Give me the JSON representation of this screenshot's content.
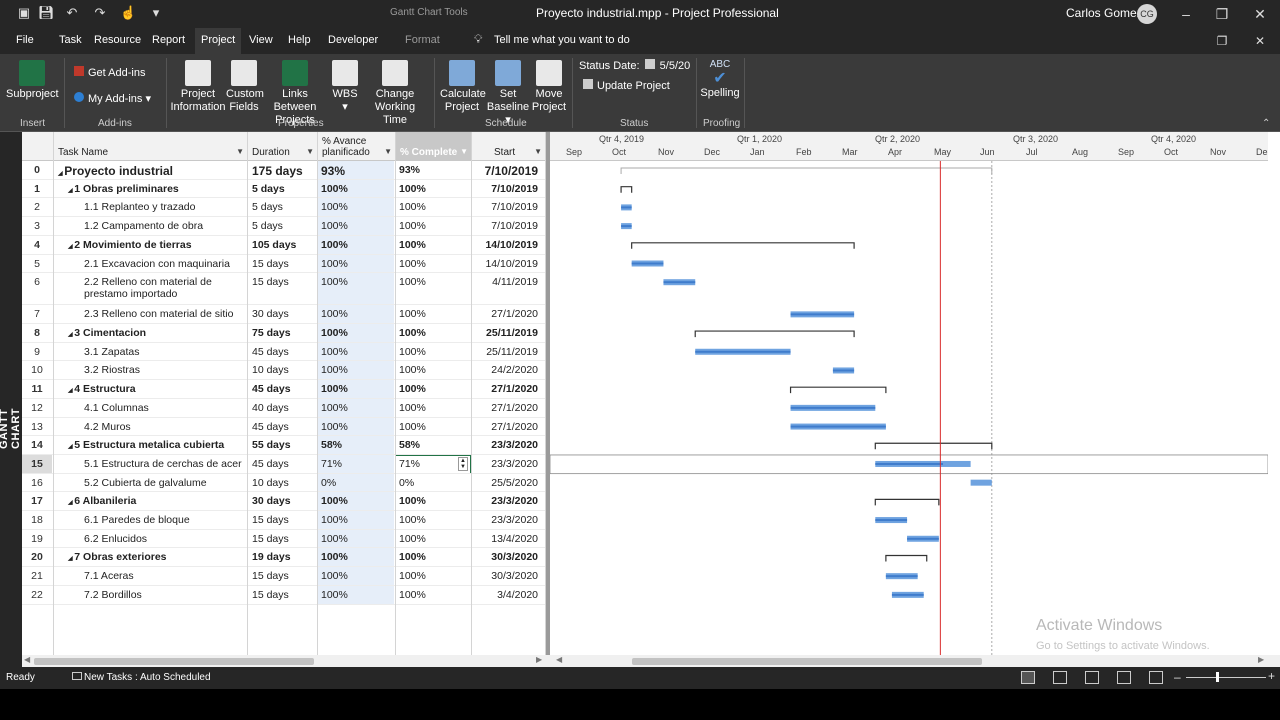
{
  "titlebar": {
    "context_tab": "Gantt Chart Tools",
    "doc_title": "Proyecto industrial.mpp  -  Project Professional",
    "user_name": "Carlos Gomez",
    "user_initials": "CG"
  },
  "tabs": [
    "File",
    "Task",
    "Resource",
    "Report",
    "Project",
    "View",
    "Help",
    "Developer",
    "Format"
  ],
  "active_tab": "Project",
  "tell_me": "Tell me what you want to do",
  "ribbon": {
    "subproject": "Subproject",
    "get_addins": "Get Add-ins",
    "my_addins": "My Add-ins",
    "project_information": [
      "Project",
      "Information"
    ],
    "custom_fields": [
      "Custom",
      "Fields"
    ],
    "links_between": [
      "Links Between",
      "Projects"
    ],
    "wbs": "WBS",
    "change_working": [
      "Change",
      "Working Time"
    ],
    "calculate_project": [
      "Calculate",
      "Project"
    ],
    "set_baseline": [
      "Set",
      "Baseline"
    ],
    "move_project": [
      "Move",
      "Project"
    ],
    "status_date_label": "Status Date:",
    "status_date_value": "5/5/20",
    "update_project": "Update Project",
    "spelling": "Spelling",
    "spelling_abc": "ABC",
    "groups": {
      "insert": "Insert",
      "addins": "Add-ins",
      "properties": "Properties",
      "schedule": "Schedule",
      "status": "Status",
      "proofing": "Proofing"
    }
  },
  "view_label": "GANTT CHART",
  "columns": {
    "name": "Task Name",
    "duration": "Duration",
    "planned": [
      "% Avance",
      "planificado"
    ],
    "complete": "% Complete",
    "start": "Start"
  },
  "tasks": [
    {
      "id": "0",
      "name": "Proyecto industrial",
      "dur": "175 days",
      "planned": "93%",
      "complete": "93%",
      "start": "7/10/2019",
      "level": 0,
      "summary": true
    },
    {
      "id": "1",
      "name": "1 Obras preliminares",
      "dur": "5 days",
      "planned": "100%",
      "complete": "100%",
      "start": "7/10/2019",
      "level": 1,
      "summary": true
    },
    {
      "id": "2",
      "name": "1.1 Replanteo y trazado",
      "dur": "5 days",
      "planned": "100%",
      "complete": "100%",
      "start": "7/10/2019",
      "level": 2,
      "summary": false
    },
    {
      "id": "3",
      "name": "1.2 Campamento de obra",
      "dur": "5 days",
      "planned": "100%",
      "complete": "100%",
      "start": "7/10/2019",
      "level": 2,
      "summary": false
    },
    {
      "id": "4",
      "name": "2 Movimiento de tierras",
      "dur": "105 days",
      "planned": "100%",
      "complete": "100%",
      "start": "14/10/2019",
      "level": 1,
      "summary": true
    },
    {
      "id": "5",
      "name": "2.1 Excavacion con maquinaria",
      "dur": "15 days",
      "planned": "100%",
      "complete": "100%",
      "start": "14/10/2019",
      "level": 2,
      "summary": false
    },
    {
      "id": "6",
      "name": "2.2 Relleno con material de",
      "name2": "prestamo importado",
      "dur": "15 days",
      "planned": "100%",
      "complete": "100%",
      "start": "4/11/2019",
      "level": 2,
      "summary": false
    },
    {
      "id": "7",
      "name": "2.3 Relleno con material de sitio",
      "dur": "30 days",
      "planned": "100%",
      "complete": "100%",
      "start": "27/1/2020",
      "level": 2,
      "summary": false
    },
    {
      "id": "8",
      "name": "3 Cimentacion",
      "dur": "75 days",
      "planned": "100%",
      "complete": "100%",
      "start": "25/11/2019",
      "level": 1,
      "summary": true
    },
    {
      "id": "9",
      "name": "3.1 Zapatas",
      "dur": "45 days",
      "planned": "100%",
      "complete": "100%",
      "start": "25/11/2019",
      "level": 2,
      "summary": false
    },
    {
      "id": "10",
      "name": "3.2 Riostras",
      "dur": "10 days",
      "planned": "100%",
      "complete": "100%",
      "start": "24/2/2020",
      "level": 2,
      "summary": false
    },
    {
      "id": "11",
      "name": "4 Estructura",
      "dur": "45 days",
      "planned": "100%",
      "complete": "100%",
      "start": "27/1/2020",
      "level": 1,
      "summary": true
    },
    {
      "id": "12",
      "name": "4.1 Columnas",
      "dur": "40 days",
      "planned": "100%",
      "complete": "100%",
      "start": "27/1/2020",
      "level": 2,
      "summary": false
    },
    {
      "id": "13",
      "name": "4.2 Muros",
      "dur": "45 days",
      "planned": "100%",
      "complete": "100%",
      "start": "27/1/2020",
      "level": 2,
      "summary": false
    },
    {
      "id": "14",
      "name": "5 Estructura metalica cubierta",
      "dur": "55 days",
      "planned": "58%",
      "complete": "58%",
      "start": "23/3/2020",
      "level": 1,
      "summary": true
    },
    {
      "id": "15",
      "name": "5.1 Estructura de cerchas de acer",
      "dur": "45 days",
      "planned": "71%",
      "complete": "71%",
      "start": "23/3/2020",
      "level": 2,
      "summary": false,
      "selected": true
    },
    {
      "id": "16",
      "name": "5.2 Cubierta de galvalume",
      "dur": "10 days",
      "planned": "0%",
      "complete": "0%",
      "start": "25/5/2020",
      "level": 2,
      "summary": false
    },
    {
      "id": "17",
      "name": "6 Albanileria",
      "dur": "30 days",
      "planned": "100%",
      "complete": "100%",
      "start": "23/3/2020",
      "level": 1,
      "summary": true
    },
    {
      "id": "18",
      "name": "6.1 Paredes de bloque",
      "dur": "15 days",
      "planned": "100%",
      "complete": "100%",
      "start": "23/3/2020",
      "level": 2,
      "summary": false
    },
    {
      "id": "19",
      "name": "6.2 Enlucidos",
      "dur": "15 days",
      "planned": "100%",
      "complete": "100%",
      "start": "13/4/2020",
      "level": 2,
      "summary": false
    },
    {
      "id": "20",
      "name": "7 Obras exteriores",
      "dur": "19 days",
      "planned": "100%",
      "complete": "100%",
      "start": "30/3/2020",
      "level": 1,
      "summary": true
    },
    {
      "id": "21",
      "name": "7.1 Aceras",
      "dur": "15 days",
      "planned": "100%",
      "complete": "100%",
      "start": "30/3/2020",
      "level": 2,
      "summary": false
    },
    {
      "id": "22",
      "name": "7.2 Bordillos",
      "dur": "15 days",
      "planned": "100%",
      "complete": "100%",
      "start": "3/4/2020",
      "level": 2,
      "summary": false
    }
  ],
  "timescale": {
    "quarters": [
      "Qtr 4, 2019",
      "Qtr 1, 2020",
      "Qtr 2, 2020",
      "Qtr 3, 2020",
      "Qtr 4, 2020"
    ],
    "months": [
      "Sep",
      "Oct",
      "Nov",
      "Dec",
      "Jan",
      "Feb",
      "Mar",
      "Apr",
      "May",
      "Jun",
      "Jul",
      "Aug",
      "Sep",
      "Oct",
      "Nov",
      "De"
    ]
  },
  "status_date": "5/5/2020",
  "watermark": {
    "title": "Activate Windows",
    "subtitle": "Go to Settings to activate Windows."
  },
  "statusbar": {
    "ready": "Ready",
    "new_tasks": "New Tasks : Auto Scheduled"
  },
  "colors": {
    "bar": "#6fa3e0",
    "bar_dark": "#3f7ccc",
    "status_line": "#d92b2b",
    "selected_border": "#217346"
  }
}
